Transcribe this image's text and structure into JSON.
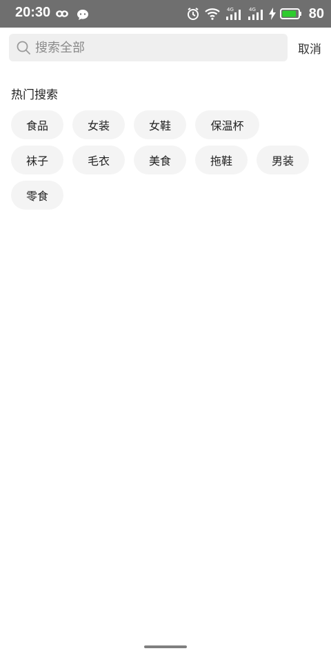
{
  "status_bar": {
    "time": "20:30",
    "battery": "80",
    "signal_1_label": "4G",
    "signal_2_label": "4G",
    "battery_color": "#2ecc2e"
  },
  "search": {
    "placeholder": "搜索全部",
    "value": "",
    "cancel_label": "取消"
  },
  "hot_search": {
    "title": "热门搜索",
    "rows": [
      [
        "食品",
        "女装",
        "女鞋",
        "保温杯"
      ],
      [
        "袜子",
        "毛衣",
        "美食",
        "拖鞋",
        "男装"
      ],
      [
        "零食"
      ]
    ]
  }
}
